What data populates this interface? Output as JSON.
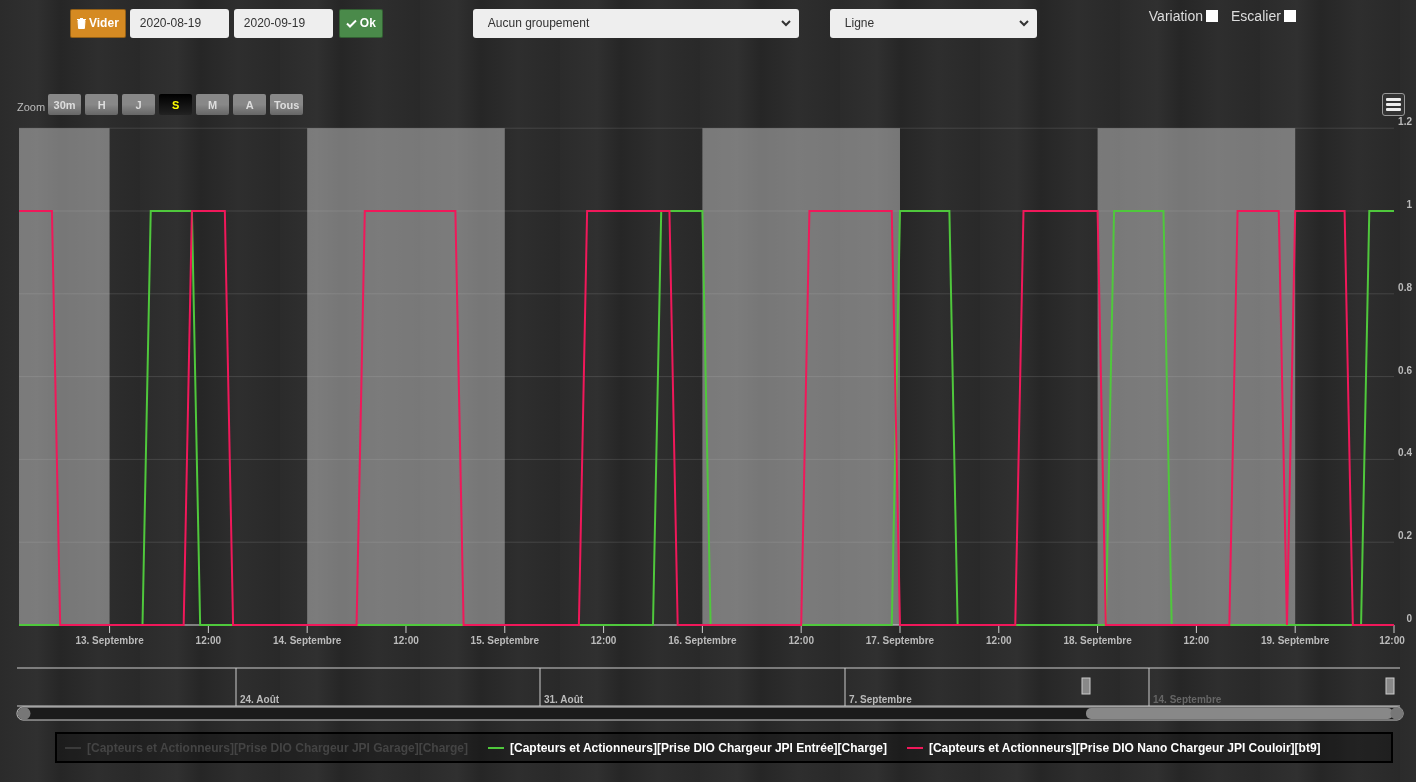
{
  "toolbar": {
    "clear_button": "Vider",
    "start_date": "2020-08-19",
    "end_date": "2020-09-19",
    "ok_button": "Ok",
    "grouping_select": "Aucun groupement",
    "type_select": "Ligne",
    "options": [
      {
        "label": "Variation",
        "checked": false
      },
      {
        "label": "Escalier",
        "checked": false
      }
    ]
  },
  "zoom": {
    "label": "Zoom",
    "buttons": [
      {
        "label": "30m",
        "selected": false
      },
      {
        "label": "H",
        "selected": false
      },
      {
        "label": "J",
        "selected": false
      },
      {
        "label": "S",
        "selected": true
      },
      {
        "label": "M",
        "selected": false
      },
      {
        "label": "A",
        "selected": false
      },
      {
        "label": "Tous",
        "selected": false
      }
    ]
  },
  "chart": {
    "chart_data": {
      "type": "line",
      "categories": [
        null,
        null,
        null,
        null,
        null,
        null,
        null,
        null,
        null,
        null,
        null,
        "13. Septembre",
        null,
        null,
        null,
        null,
        null,
        null,
        null,
        null,
        null,
        null,
        null,
        "12:00",
        null,
        null,
        null,
        null,
        null,
        null,
        null,
        null,
        null,
        null,
        null,
        "14. Septembre",
        null,
        null,
        null,
        null,
        null,
        null,
        null,
        null,
        null,
        null,
        null,
        "12:00",
        null,
        null,
        null,
        null,
        null,
        null,
        null,
        null,
        null,
        null,
        null,
        "15. Septembre",
        null,
        null,
        null,
        null,
        null,
        null,
        null,
        null,
        null,
        null,
        null,
        "12:00",
        null,
        null,
        null,
        null,
        null,
        null,
        null,
        null,
        null,
        null,
        null,
        "16. Septembre",
        null,
        null,
        null,
        null,
        null,
        null,
        null,
        null,
        null,
        null,
        null,
        "12:00",
        null,
        null,
        null,
        null,
        null,
        null,
        null,
        null,
        null,
        null,
        null,
        "17. Septembre",
        null,
        null,
        null,
        null,
        null,
        null,
        null,
        null,
        null,
        null,
        null,
        "12:00",
        null,
        null,
        null,
        null,
        null,
        null,
        null,
        null,
        null,
        null,
        null,
        "18. Septembre",
        null,
        null,
        null,
        null,
        null,
        null,
        null,
        null,
        null,
        null,
        null,
        "12:00",
        null,
        null,
        null,
        null,
        null,
        null,
        null,
        null,
        null,
        null,
        null,
        "19. Septembre",
        null,
        null,
        null,
        null,
        null,
        null,
        null,
        null,
        null,
        null,
        null,
        "12:00"
      ],
      "series": [
        {
          "name": "[Capteurs et Actionneurs][Prise DIO Chargeur JPI Garage][Charge]",
          "color": "#3a3a3a",
          "values": [
            null,
            null,
            null,
            null,
            null,
            null,
            null,
            null,
            null,
            null,
            null,
            null,
            null,
            null,
            null,
            null,
            null,
            null,
            null,
            null,
            null,
            null,
            null,
            null,
            null,
            null,
            null,
            null,
            null,
            null,
            null,
            null,
            null,
            null,
            null,
            null,
            null,
            null,
            null,
            null,
            null,
            null,
            null,
            null,
            null,
            null,
            null,
            null,
            null,
            null,
            null,
            null,
            null,
            null,
            null,
            null,
            null,
            null,
            null,
            null,
            null,
            null,
            null,
            null,
            null,
            null,
            null,
            null,
            null,
            null,
            null,
            null,
            null,
            null,
            null,
            null,
            null,
            null,
            null,
            null,
            null,
            null,
            null,
            null,
            null,
            null,
            null,
            null,
            null,
            null,
            null,
            null,
            null,
            null,
            null,
            null,
            null,
            null,
            null,
            null,
            null,
            null,
            null,
            null,
            null,
            null,
            null,
            null,
            null,
            null,
            null,
            null,
            null,
            null,
            null,
            null,
            null,
            null,
            null,
            null,
            null,
            null,
            null,
            null,
            null,
            null,
            null,
            null,
            null,
            null,
            null,
            null,
            null,
            null,
            null,
            null,
            null,
            null,
            null,
            null,
            null,
            null,
            null,
            null,
            null,
            null,
            null,
            null,
            null,
            null,
            null,
            null,
            null,
            null,
            null,
            null,
            null,
            null,
            null,
            null,
            null,
            null,
            null,
            null,
            null,
            null,
            null,
            null
          ]
        },
        {
          "name": "[Capteurs et Actionneurs][Prise DIO Chargeur JPI Entrée][Charge]",
          "color": "#4fc83c",
          "values": [
            0,
            0,
            0,
            0,
            0,
            0,
            0,
            0,
            0,
            0,
            0,
            0,
            0,
            0,
            0,
            0,
            1,
            1,
            1,
            1,
            1,
            1,
            0,
            0,
            0,
            0,
            0,
            0,
            0,
            0,
            0,
            0,
            0,
            0,
            0,
            0,
            0,
            0,
            0,
            0,
            0,
            0,
            0,
            0,
            0,
            0,
            0,
            0,
            0,
            0,
            0,
            0,
            0,
            0,
            0,
            0,
            0,
            0,
            0,
            0,
            0,
            0,
            0,
            0,
            0,
            0,
            0,
            0,
            0,
            0,
            0,
            0,
            0,
            0,
            0,
            0,
            0,
            0,
            1,
            1,
            1,
            1,
            1,
            1,
            0,
            0,
            0,
            0,
            0,
            0,
            0,
            0,
            0,
            0,
            0,
            0,
            0,
            0,
            0,
            0,
            0,
            0,
            0,
            0,
            0,
            0,
            0,
            1,
            1,
            1,
            1,
            1,
            1,
            1,
            0,
            0,
            0,
            0,
            0,
            0,
            0,
            0,
            0,
            0,
            0,
            0,
            0,
            0,
            0,
            0,
            0,
            0,
            0,
            1,
            1,
            1,
            1,
            1,
            1,
            1,
            0,
            0,
            0,
            0,
            0,
            0,
            0,
            0,
            0,
            0,
            0,
            0,
            0,
            0,
            0,
            0,
            0,
            0,
            0,
            0,
            0,
            0,
            0,
            0,
            1,
            1,
            1,
            1
          ]
        },
        {
          "name": "[Capteurs et Actionneurs][Prise DIO Nano Chargeur JPI Couloir][bt9]",
          "color": "#f0185a",
          "values": [
            1,
            1,
            1,
            1,
            1,
            0,
            0,
            0,
            0,
            0,
            0,
            0,
            0,
            0,
            0,
            0,
            0,
            0,
            0,
            0,
            0,
            1,
            1,
            1,
            1,
            1,
            0,
            0,
            0,
            0,
            0,
            0,
            0,
            0,
            0,
            0,
            0,
            0,
            0,
            0,
            0,
            0,
            1,
            1,
            1,
            1,
            1,
            1,
            1,
            1,
            1,
            1,
            1,
            1,
            0,
            0,
            0,
            0,
            0,
            0,
            0,
            0,
            0,
            0,
            0,
            0,
            0,
            0,
            0,
            1,
            1,
            1,
            1,
            1,
            1,
            1,
            1,
            1,
            1,
            1,
            0,
            0,
            0,
            0,
            0,
            0,
            0,
            0,
            0,
            0,
            0,
            0,
            0,
            0,
            0,
            0,
            1,
            1,
            1,
            1,
            1,
            1,
            1,
            1,
            1,
            1,
            1,
            0,
            0,
            0,
            0,
            0,
            0,
            0,
            0,
            0,
            0,
            0,
            0,
            0,
            0,
            0,
            1,
            1,
            1,
            1,
            1,
            1,
            1,
            1,
            1,
            1,
            0,
            0,
            0,
            0,
            0,
            0,
            0,
            0,
            0,
            0,
            0,
            0,
            0,
            0,
            0,
            0,
            1,
            1,
            1,
            1,
            1,
            1,
            0,
            1,
            1,
            1,
            1,
            1,
            1,
            1,
            0,
            0,
            0,
            0,
            0,
            0
          ]
        }
      ],
      "ylim": [
        0,
        1.2
      ],
      "grid": true,
      "yticks": [
        {
          "value": 0,
          "label": "0"
        },
        {
          "value": 0.2,
          "label": "0.2"
        },
        {
          "value": 0.4,
          "label": "0.4"
        },
        {
          "value": 0.6,
          "label": "0.6"
        },
        {
          "value": 0.8,
          "label": "0.8"
        },
        {
          "value": 1,
          "label": "1"
        },
        {
          "value": 1.2,
          "label": "1.2"
        }
      ]
    },
    "legend": [
      {
        "visible": false
      },
      {
        "visible": true
      },
      {
        "visible": true
      }
    ]
  },
  "navigator": {
    "labels": [
      "24. Août",
      "31. Août",
      "7. Septembre",
      "14. Septembre"
    ]
  }
}
